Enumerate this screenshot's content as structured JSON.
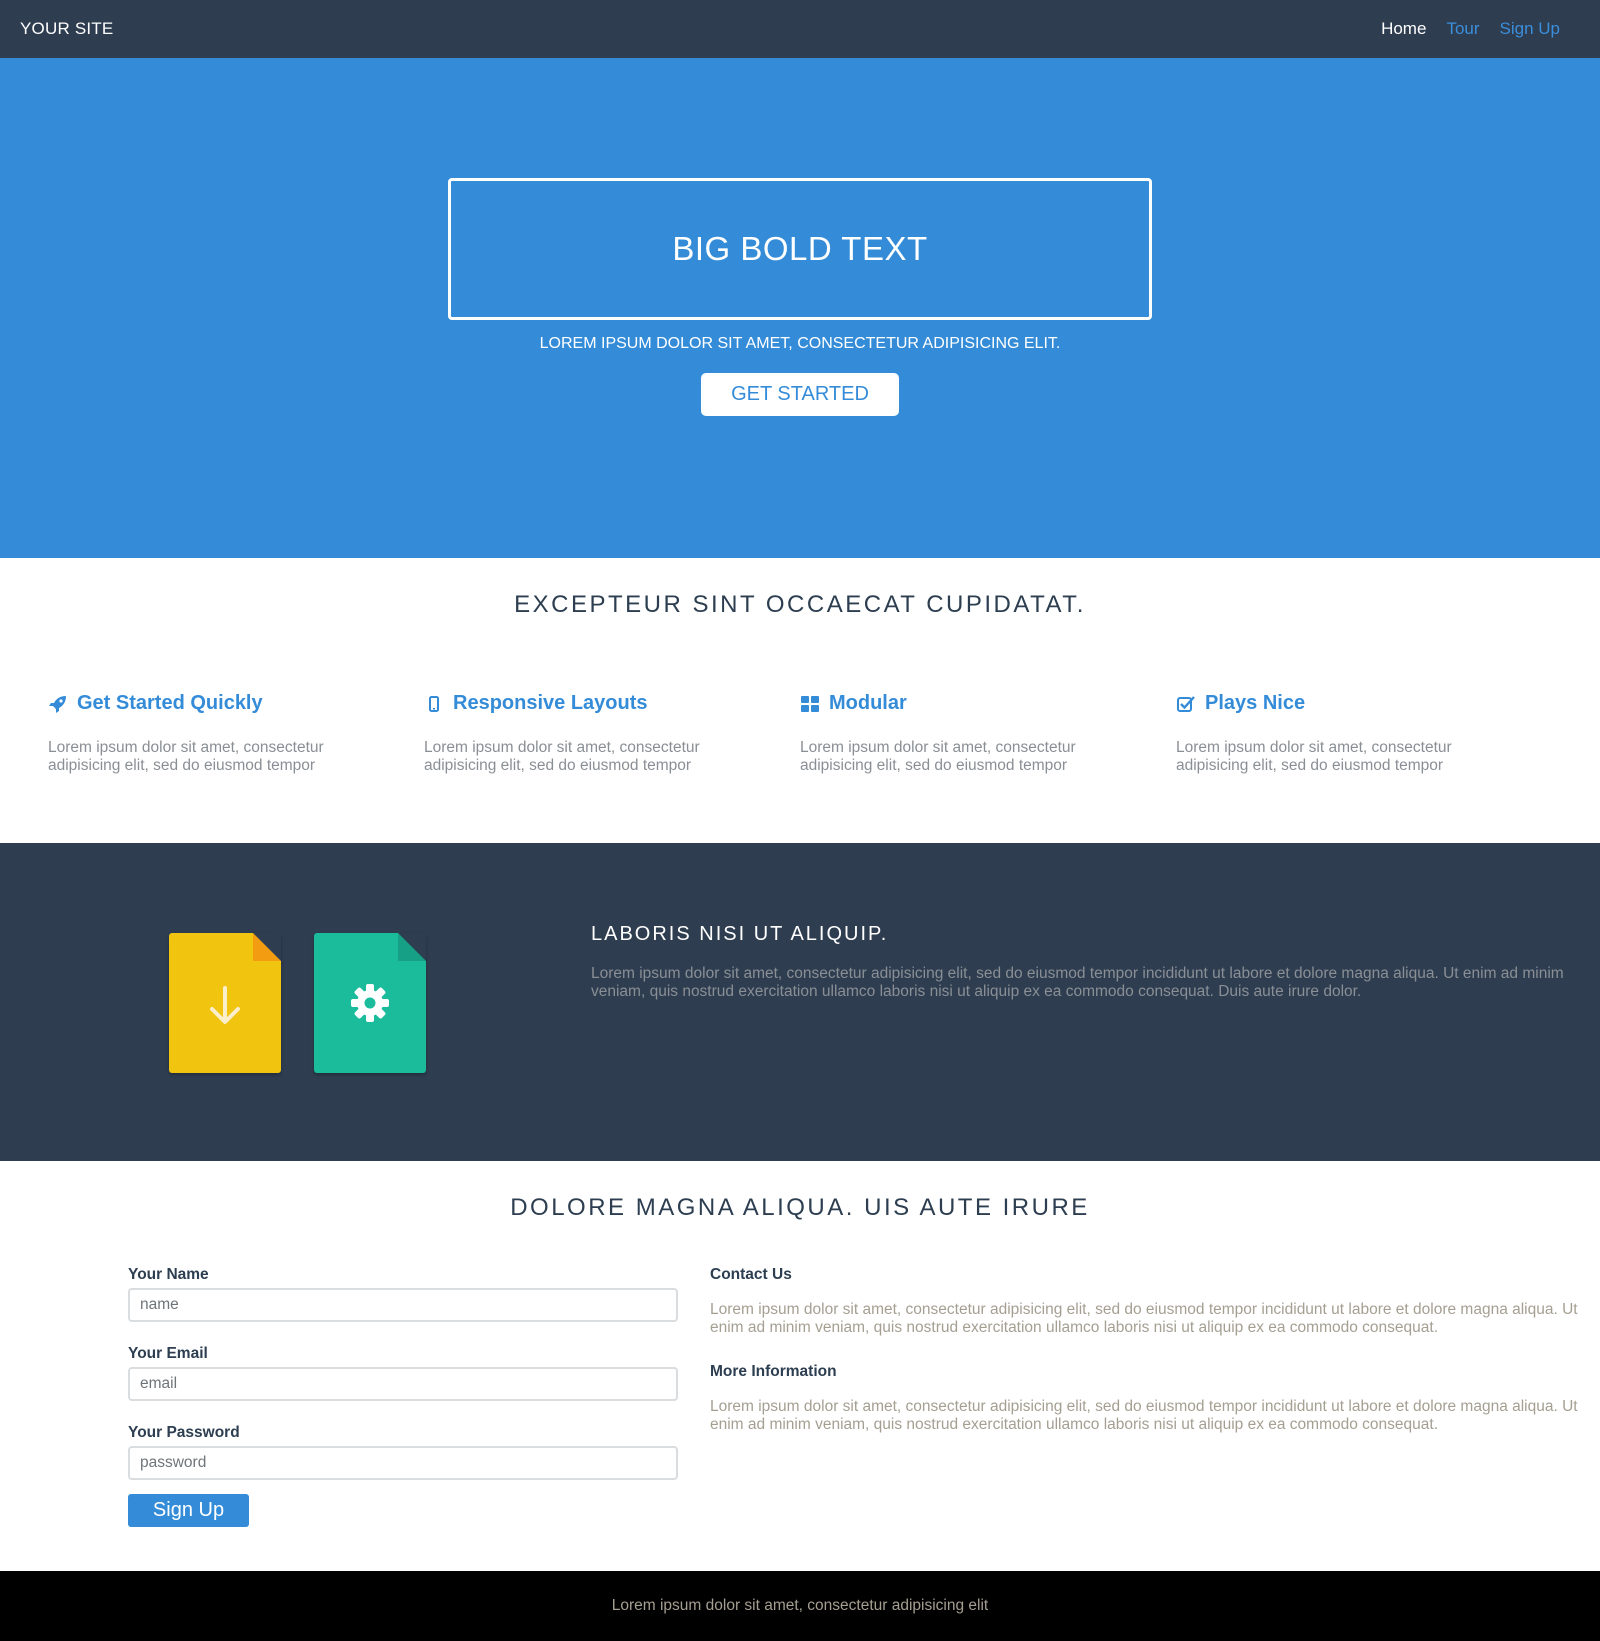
{
  "navbar": {
    "brand": "YOUR SITE",
    "links": [
      {
        "label": "Home",
        "active": true
      },
      {
        "label": "Tour",
        "active": false
      },
      {
        "label": "Sign Up",
        "active": false
      }
    ]
  },
  "hero": {
    "title": "BIG BOLD TEXT",
    "subtitle": "LOREM IPSUM DOLOR SIT AMET, CONSECTETUR ADIPISICING ELIT.",
    "button": "GET STARTED"
  },
  "features": {
    "title": "EXCEPTEUR SINT OCCAECAT CUPIDATAT.",
    "items": [
      {
        "icon": "rocket-icon",
        "title": "Get Started Quickly",
        "text": "Lorem ipsum dolor sit amet, consectetur adipisicing elit, sed do eiusmod tempor"
      },
      {
        "icon": "mobile-icon",
        "title": "Responsive Layouts",
        "text": "Lorem ipsum dolor sit amet, consectetur adipisicing elit, sed do eiusmod tempor"
      },
      {
        "icon": "grid-icon",
        "title": "Modular",
        "text": "Lorem ipsum dolor sit amet, consectetur adipisicing elit, sed do eiusmod tempor"
      },
      {
        "icon": "checkbox-icon",
        "title": "Plays Nice",
        "text": "Lorem ipsum dolor sit amet, consectetur adipisicing elit, sed do eiusmod tempor"
      }
    ]
  },
  "dark_section": {
    "title": "LABORIS NISI UT ALIQUIP.",
    "text": "Lorem ipsum dolor sit amet, consectetur adipisicing elit, sed do eiusmod tempor incididunt ut labore et dolore magna aliqua. Ut enim ad minim veniam, quis nostrud exercitation ullamco laboris nisi ut aliquip ex ea commodo consequat. Duis aute irure dolor.",
    "icons": [
      "download-file-icon",
      "settings-file-icon"
    ]
  },
  "signup": {
    "title": "DOLORE MAGNA ALIQUA. UIS AUTE IRURE",
    "fields": [
      {
        "label": "Your Name",
        "placeholder": "name"
      },
      {
        "label": "Your Email",
        "placeholder": "email"
      },
      {
        "label": "Your Password",
        "placeholder": "password"
      }
    ],
    "button": "Sign Up",
    "contact_title": "Contact Us",
    "contact_text": "Lorem ipsum dolor sit amet, consectetur adipisicing elit, sed do eiusmod tempor incididunt ut labore et dolore magna aliqua. Ut enim ad minim veniam, quis nostrud exercitation ullamco laboris nisi ut aliquip ex ea commodo consequat.",
    "more_title": "More Information",
    "more_text": "Lorem ipsum dolor sit amet, consectetur adipisicing elit, sed do eiusmod tempor incididunt ut labore et dolore magna aliqua. Ut enim ad minim veniam, quis nostrud exercitation ullamco laboris nisi ut aliquip ex ea commodo consequat."
  },
  "footer": {
    "text": "Lorem ipsum dolor sit amet, consectetur adipisicing elit"
  },
  "colors": {
    "navbar": "#2e3d50",
    "primary": "#348cd8",
    "dark_section": "#2e3d50",
    "yellow_doc": "#f1c40f",
    "green_doc": "#1abc9c",
    "footer": "#000000"
  }
}
